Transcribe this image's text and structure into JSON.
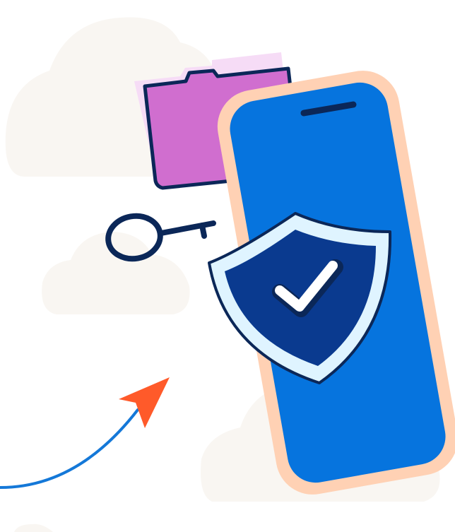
{
  "illustration": {
    "icons": {
      "folder": "folder-icon",
      "key": "key-icon",
      "phone": "smartphone-icon",
      "shield": "shield-check-icon",
      "arrow": "paper-plane-arrow-icon",
      "cloud": "cloud-icon"
    },
    "colors": {
      "background": "#ffffff",
      "cloud": "#f9f6f2",
      "folder": "#d06ecf",
      "folder_back": "#f6dcf6",
      "outline": "#0b2758",
      "phone_frame": "#ffd1b4",
      "phone_screen": "#0674de",
      "shield": "#0a3a8f",
      "shield_rim": "#dff4ff",
      "check": "#ffffff",
      "arrow_head": "#ff5a2a",
      "arrow_line": "#1478d8"
    }
  }
}
